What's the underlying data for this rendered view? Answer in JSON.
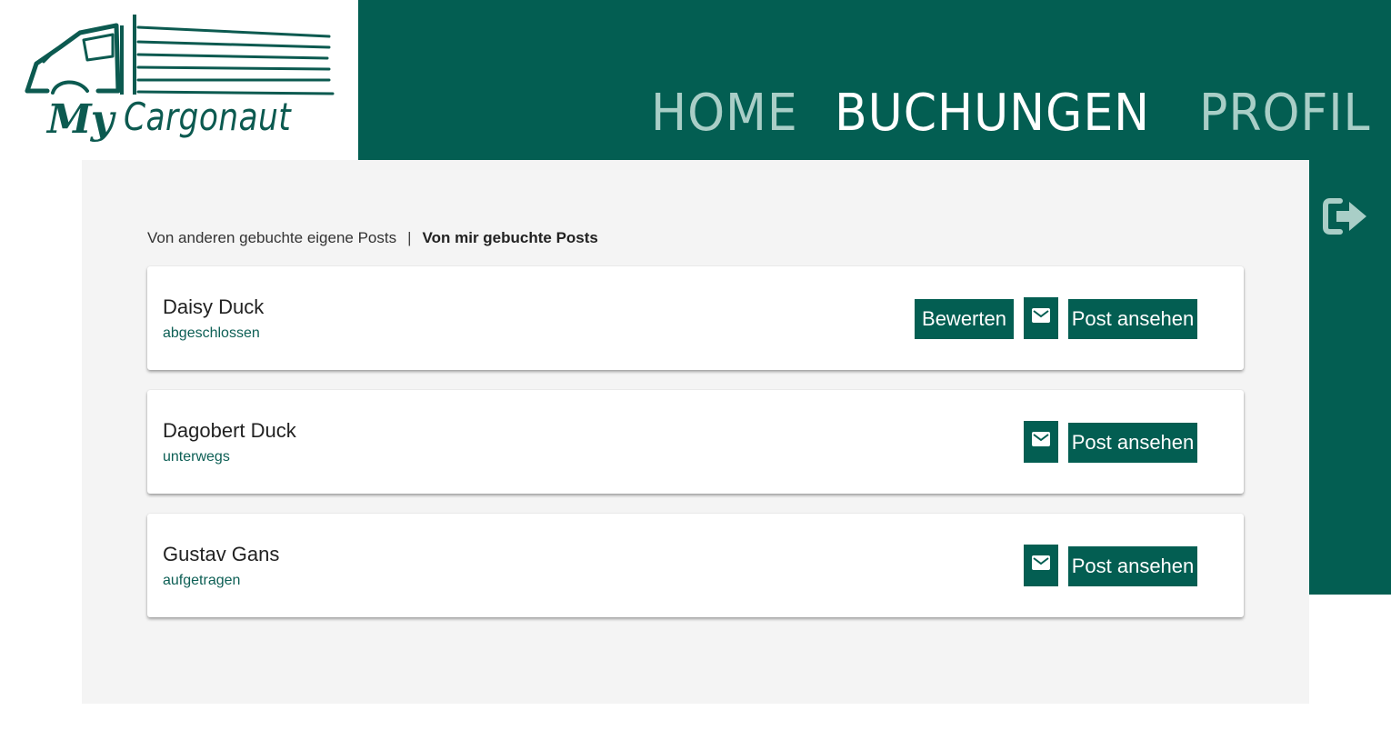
{
  "logo": {
    "my": "My",
    "name": "Cargonaut"
  },
  "nav": {
    "home": "HOME",
    "bookings": "BUCHUNGEN",
    "profile": "PROFIL"
  },
  "subnav": {
    "others_booked": "Von anderen gebuchte eigene Posts",
    "separator": "|",
    "my_booked": "Von mir gebuchte Posts"
  },
  "bookings": [
    {
      "name": "Daisy Duck",
      "status": "abgeschlossen",
      "rate_label": "Bewerten",
      "post_label": "Post ansehen"
    },
    {
      "name": "Dagobert Duck",
      "status": "unterwegs",
      "post_label": "Post ansehen"
    },
    {
      "name": "Gustav Gans",
      "status": "aufgetragen",
      "post_label": "Post ansehen"
    }
  ],
  "icons": {
    "logout": "logout-icon",
    "mail": "mail-icon",
    "truck": "truck-logo-icon"
  },
  "colors": {
    "primary": "#035e52",
    "nav_inactive": "#a9cec7",
    "nav_active": "#ffffff",
    "content_bg": "#f4f4f4",
    "status_text": "#0d5f55"
  }
}
